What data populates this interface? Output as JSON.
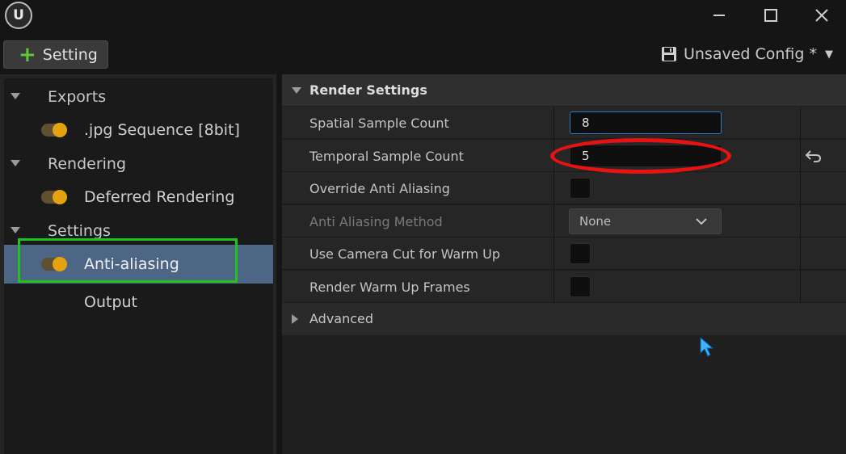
{
  "titlebar": {
    "logo_text": "U",
    "controls": [
      "minimize",
      "maximize",
      "close"
    ]
  },
  "toolbar": {
    "add_setting_label": "Setting",
    "config_label": "Unsaved Config *",
    "config_icon": "floppy-disk-icon"
  },
  "tree": {
    "categories": [
      {
        "label": "Exports",
        "items": [
          {
            "label": ".jpg Sequence [8bit]",
            "enabled": true
          }
        ]
      },
      {
        "label": "Rendering",
        "items": [
          {
            "label": "Deferred Rendering",
            "enabled": true
          }
        ]
      },
      {
        "label": "Settings",
        "items": [
          {
            "label": "Anti-aliasing",
            "enabled": true,
            "selected": true
          },
          {
            "label": "Output",
            "enabled": false
          }
        ]
      }
    ]
  },
  "details": {
    "section_title": "Render Settings",
    "properties": [
      {
        "name": "Spatial Sample Count",
        "type": "number",
        "value": "8"
      },
      {
        "name": "Temporal Sample Count",
        "type": "number",
        "value": "5"
      },
      {
        "name": "Override Anti Aliasing",
        "type": "checkbox",
        "checked": false
      },
      {
        "name": "Anti Aliasing Method",
        "type": "dropdown",
        "value": "None"
      },
      {
        "name": "Use Camera Cut for Warm Up",
        "type": "checkbox",
        "checked": false
      },
      {
        "name": "Render Warm Up Frames",
        "type": "checkbox",
        "checked": false
      }
    ],
    "advanced_label": "Advanced"
  },
  "colors": {
    "accent_green": "#22c11d",
    "annotation_red": "#e81212",
    "toggle_on": "#e5a310",
    "selection": "#4d6685"
  }
}
